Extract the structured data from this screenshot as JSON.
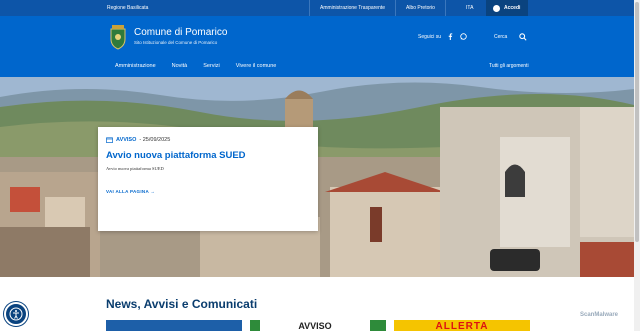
{
  "slim_header": {
    "region": "Regione Basilicata",
    "links": [
      "Amministrazione Trasparente",
      "Albo Pretorio"
    ],
    "language": "ITA",
    "login": "Accedi"
  },
  "header": {
    "title": "Comune di Pomarico",
    "subtitle": "Sito Istituzionale del Comune di Pomarico",
    "social_label": "Seguici su",
    "search_label": "Cerca"
  },
  "nav": {
    "items": [
      "Amministrazione",
      "Novità",
      "Servizi",
      "Vivere il comune"
    ],
    "all_topics": "Tutti gli argomenti"
  },
  "hero_card": {
    "category": "AVVISO",
    "date": "- 25/09/2025",
    "title": "Avvio nuova piattaforma SUED",
    "description": "Avvio nuova piattaforma SUED",
    "more": "VAI ALLA PAGINA"
  },
  "news": {
    "title": "News, Avvisi e Comunicati",
    "thumb2_text": "AVVISO",
    "thumb3_text": "ALLERTA"
  },
  "watermark": "ScanMalware",
  "colors": {
    "primary": "#0066cc",
    "slim": "#0d55a8",
    "dark": "#0a437f"
  }
}
